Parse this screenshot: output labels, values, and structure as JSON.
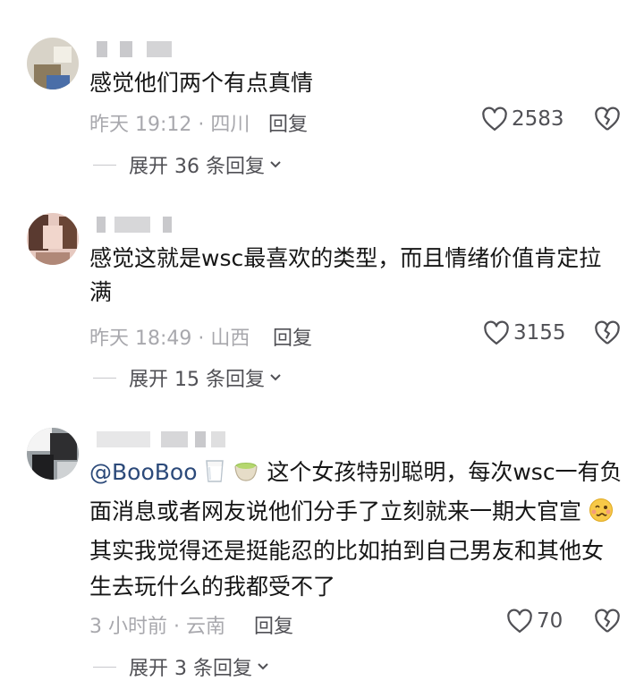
{
  "comments": [
    {
      "text": "感觉他们两个有点真情",
      "meta": "昨天 19:12 · 四川",
      "reply_label": "回复",
      "likes": "2583",
      "expand_label": "展开 36 条回复"
    },
    {
      "text": "感觉这就是wsc最喜欢的类型，而且情绪价值肯定拉满",
      "meta": "昨天 18:49 · 山西",
      "reply_label": "回复",
      "likes": "3155",
      "expand_label": "展开 15 条回复"
    },
    {
      "mention": "@BooBoo",
      "text": "这个女孩特别聪明，每次wsc一有负面消息或者网友说他们分手了立刻就来一期大官宣",
      "text2": "其实我觉得还是挺能忍的比如拍到自己男友和其他女生去玩什么的我都受不了",
      "meta": "3 小时前 · 云南",
      "reply_label": "回复",
      "likes": "70",
      "expand_label": "展开 3 条回复"
    }
  ],
  "icons": {
    "like": "heart-outline-icon",
    "dislike": "broken-heart-icon",
    "expand": "chevron-down-icon",
    "emoji_1": "milk-glass-emoji",
    "emoji_2": "green-tea-emoji",
    "emoji_3": "woozy-face-emoji"
  },
  "colors": {
    "text": "#161616",
    "meta": "#a8a8ad",
    "action": "#505055",
    "mention": "#2c4a7a",
    "background": "#ffffff"
  }
}
